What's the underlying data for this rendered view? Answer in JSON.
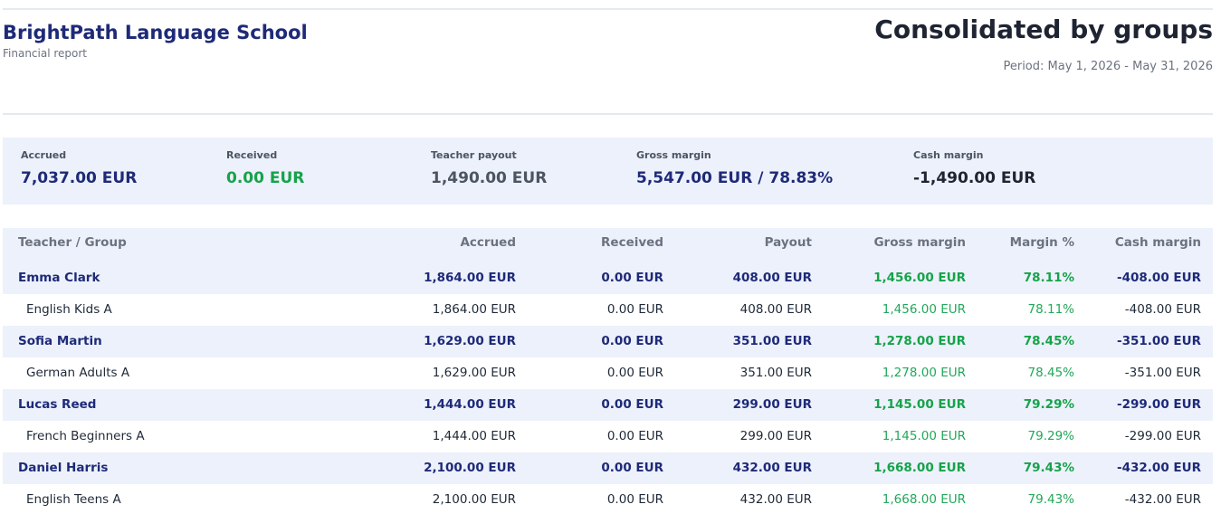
{
  "header": {
    "school_name": "BrightPath Language School",
    "report_type": "Financial report",
    "title": "Consolidated by groups",
    "period": "Period: May 1, 2026 - May 31, 2026"
  },
  "summary": [
    {
      "label": "Accrued",
      "value": "7,037.00 EUR",
      "color": "#1e2a78"
    },
    {
      "label": "Received",
      "value": "0.00 EUR",
      "color": "#16a34a"
    },
    {
      "label": "Teacher payout",
      "value": "1,490.00 EUR",
      "color": "#4b5563"
    },
    {
      "label": "Gross margin",
      "value": "5,547.00 EUR / 78.83%",
      "color": "#1e2a78"
    },
    {
      "label": "Cash margin",
      "value": "-1,490.00 EUR",
      "color": "#1f2433"
    }
  ],
  "table": {
    "columns": [
      "Teacher / Group",
      "Accrued",
      "Received",
      "Payout",
      "Gross margin",
      "Margin %",
      "Cash margin"
    ],
    "rows": [
      {
        "type": "teacher",
        "cells": [
          "Emma Clark",
          "1,864.00 EUR",
          "0.00 EUR",
          "408.00 EUR",
          "1,456.00 EUR",
          "78.11%",
          "-408.00 EUR"
        ]
      },
      {
        "type": "group",
        "cells": [
          "English Kids A",
          "1,864.00 EUR",
          "0.00 EUR",
          "408.00 EUR",
          "1,456.00 EUR",
          "78.11%",
          "-408.00 EUR"
        ]
      },
      {
        "type": "teacher",
        "cells": [
          "Sofia Martin",
          "1,629.00 EUR",
          "0.00 EUR",
          "351.00 EUR",
          "1,278.00 EUR",
          "78.45%",
          "-351.00 EUR"
        ]
      },
      {
        "type": "group",
        "cells": [
          "German Adults A",
          "1,629.00 EUR",
          "0.00 EUR",
          "351.00 EUR",
          "1,278.00 EUR",
          "78.45%",
          "-351.00 EUR"
        ]
      },
      {
        "type": "teacher",
        "cells": [
          "Lucas Reed",
          "1,444.00 EUR",
          "0.00 EUR",
          "299.00 EUR",
          "1,145.00 EUR",
          "79.29%",
          "-299.00 EUR"
        ]
      },
      {
        "type": "group",
        "cells": [
          "French Beginners A",
          "1,444.00 EUR",
          "0.00 EUR",
          "299.00 EUR",
          "1,145.00 EUR",
          "79.29%",
          "-299.00 EUR"
        ]
      },
      {
        "type": "teacher",
        "cells": [
          "Daniel Harris",
          "2,100.00 EUR",
          "0.00 EUR",
          "432.00 EUR",
          "1,668.00 EUR",
          "79.43%",
          "-432.00 EUR"
        ]
      },
      {
        "type": "group",
        "cells": [
          "English Teens A",
          "2,100.00 EUR",
          "0.00 EUR",
          "432.00 EUR",
          "1,668.00 EUR",
          "79.43%",
          "-432.00 EUR"
        ]
      }
    ]
  }
}
